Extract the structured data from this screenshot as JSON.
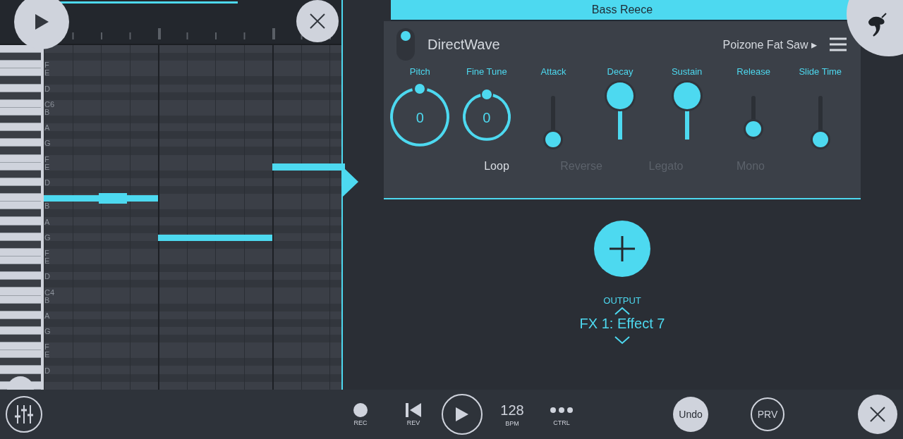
{
  "piano_roll": {
    "rows": [
      {
        "label": "",
        "black": false
      },
      {
        "label": "",
        "black": true
      },
      {
        "label": "F",
        "black": false
      },
      {
        "label": "E",
        "black": false
      },
      {
        "label": "",
        "black": true
      },
      {
        "label": "D",
        "black": false
      },
      {
        "label": "",
        "black": true
      },
      {
        "label": "C6",
        "black": false
      },
      {
        "label": "B",
        "black": false
      },
      {
        "label": "",
        "black": true
      },
      {
        "label": "A",
        "black": false
      },
      {
        "label": "",
        "black": true
      },
      {
        "label": "G",
        "black": false
      },
      {
        "label": "",
        "black": true
      },
      {
        "label": "F",
        "black": false
      },
      {
        "label": "E",
        "black": false
      },
      {
        "label": "",
        "black": true
      },
      {
        "label": "D",
        "black": false
      },
      {
        "label": "",
        "black": true
      },
      {
        "label": "",
        "black": false
      },
      {
        "label": "B",
        "black": false
      },
      {
        "label": "",
        "black": true
      },
      {
        "label": "A",
        "black": false
      },
      {
        "label": "",
        "black": true
      },
      {
        "label": "G",
        "black": false
      },
      {
        "label": "",
        "black": true
      },
      {
        "label": "F",
        "black": false
      },
      {
        "label": "E",
        "black": false
      },
      {
        "label": "",
        "black": true
      },
      {
        "label": "D",
        "black": false
      },
      {
        "label": "",
        "black": true
      },
      {
        "label": "C4",
        "black": false
      },
      {
        "label": "B",
        "black": false
      },
      {
        "label": "",
        "black": true
      },
      {
        "label": "A",
        "black": false
      },
      {
        "label": "",
        "black": true
      },
      {
        "label": "G",
        "black": false
      },
      {
        "label": "",
        "black": true
      },
      {
        "label": "F",
        "black": false
      },
      {
        "label": "E",
        "black": false
      },
      {
        "label": "",
        "black": true
      },
      {
        "label": "D",
        "black": false
      },
      {
        "label": "",
        "black": true
      },
      {
        "label": "",
        "black": false
      }
    ]
  },
  "channel": {
    "title": "Bass Reece",
    "power_on": true,
    "plugin": "DirectWave",
    "preset": "Poizone Fat Saw",
    "preset_arrow": "▸",
    "knobs": [
      {
        "label": "Pitch",
        "value": "0"
      },
      {
        "label": "Fine Tune",
        "value": "0"
      }
    ],
    "sliders": [
      {
        "label": "Attack",
        "kind": "small",
        "level": 0
      },
      {
        "label": "Decay",
        "kind": "large",
        "level": 1
      },
      {
        "label": "Sustain",
        "kind": "large",
        "level": 1
      },
      {
        "label": "Release",
        "kind": "small",
        "level": 0.25
      },
      {
        "label": "Slide Time",
        "kind": "small",
        "level": 0
      }
    ],
    "toggles": [
      {
        "label": "Loop",
        "on": true
      },
      {
        "label": "Reverse",
        "on": false
      },
      {
        "label": "Legato",
        "on": false
      },
      {
        "label": "Mono",
        "on": false
      }
    ]
  },
  "output": {
    "label": "OUTPUT",
    "value": "FX 1: Effect 7"
  },
  "transport": {
    "rec": "REC",
    "rev": "REV",
    "bpm_value": "128",
    "bpm": "BPM",
    "ctrl": "CTRL",
    "undo": "Undo",
    "prv": "PRV"
  }
}
